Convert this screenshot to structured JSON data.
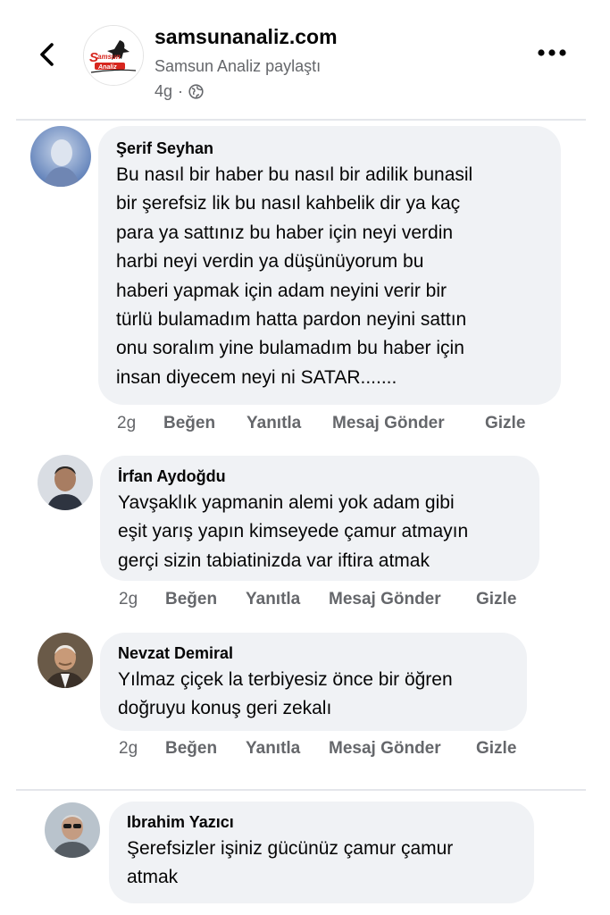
{
  "header": {
    "page_name": "samsunanaliz.com",
    "shared_text": "Samsun Analiz paylaştı",
    "time": "4g",
    "separator": "·",
    "logo_text": "Samsun Analiz",
    "icons": [
      "back-arrow-icon",
      "globe-icon",
      "more-options-icon"
    ]
  },
  "comments": [
    {
      "author": "Şerif Seyhan",
      "text": "Bu nasıl bir haber bu nasıl bir adilik bunasil\nbir şerefsiz lik bu nasıl kahbelik dir ya kaç\npara ya sattınız bu haber için neyi verdin\nharbi neyi verdin ya düşünüyorum bu\nhaberi yapmak için adam neyini verir bir\ntürlü bulamadım hatta pardon neyini sattın\nonu soralım yine bulamadım bu haber için\ninsan diyecem neyi ni SATAR.......",
      "time": "2g",
      "like": "Beğen",
      "reply": "Yanıtla",
      "message": "Mesaj Gönder",
      "hide": "Gizle"
    },
    {
      "author": "İrfan Aydoğdu",
      "text": "Yavşaklık yapmanin alemi yok adam gibi\neşit yarış yapın kimseyede çamur atmayın\ngerçi sizin tabiatinizda var iftira atmak",
      "time": "2g",
      "like": "Beğen",
      "reply": "Yanıtla",
      "message": "Mesaj Gönder",
      "hide": "Gizle"
    },
    {
      "author": "Nevzat Demiral",
      "text": "Yılmaz çiçek la terbiyesiz önce bir öğren\ndoğruyu  konuş  geri  zekalı",
      "time": "2g",
      "like": "Beğen",
      "reply": "Yanıtla",
      "message": "Mesaj Gönder",
      "hide": "Gizle"
    },
    {
      "author": "Ibrahim Yazıcı",
      "text": "Şerefsizler işiniz gücünüz çamur çamur\natmak"
    }
  ],
  "colors": {
    "bubble": "#f0f2f5",
    "secondary_text": "#65676b",
    "divider": "#e4e6eb",
    "logo_red": "#d7261e"
  }
}
